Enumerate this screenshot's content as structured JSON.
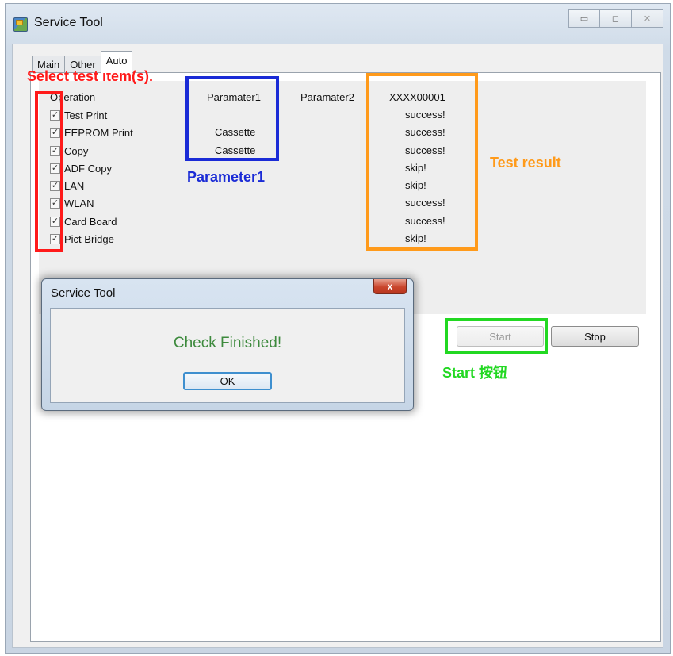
{
  "window": {
    "title": "Service Tool",
    "controls": {
      "minimize": "▭",
      "maximize": "◻",
      "close": "✕"
    }
  },
  "tabs": [
    {
      "label": "Main",
      "active": false
    },
    {
      "label": "Other",
      "active": false
    },
    {
      "label": "Auto",
      "active": true
    }
  ],
  "table": {
    "headers": {
      "operation": "Operation",
      "param1": "Paramater1",
      "param2": "Paramater2",
      "result": "XXXX00001"
    },
    "rows": [
      {
        "name": "Test Print",
        "checked": true,
        "param1": "",
        "result": "success!"
      },
      {
        "name": "EEPROM Print",
        "checked": true,
        "param1": "Cassette",
        "result": "success!"
      },
      {
        "name": "Copy",
        "checked": true,
        "param1": "Cassette",
        "result": "success!"
      },
      {
        "name": "ADF Copy",
        "checked": true,
        "param1": "",
        "result": "skip!"
      },
      {
        "name": "LAN",
        "checked": true,
        "param1": "",
        "result": "skip!"
      },
      {
        "name": "WLAN",
        "checked": true,
        "param1": "",
        "result": "success!"
      },
      {
        "name": "Card Board",
        "checked": true,
        "param1": "",
        "result": "success!"
      },
      {
        "name": "Pict Bridge",
        "checked": true,
        "param1": "",
        "result": "skip!"
      }
    ]
  },
  "buttons": {
    "start": "Start",
    "stop": "Stop"
  },
  "dialog": {
    "title": "Service Tool",
    "message": "Check Finished!",
    "ok": "OK",
    "close": "x"
  },
  "annotations": {
    "select_items": {
      "text": "Select test item(s).",
      "color": "#ff1a1a"
    },
    "parameter1": {
      "text": "Parameter1",
      "color": "#1a2bd6"
    },
    "test_result": {
      "text": "Test result",
      "color": "#ff9a1a"
    },
    "start_button": {
      "text": "Start 按钮",
      "color": "#22d822"
    }
  },
  "colors": {
    "check_finished": "#3d8a3d"
  }
}
